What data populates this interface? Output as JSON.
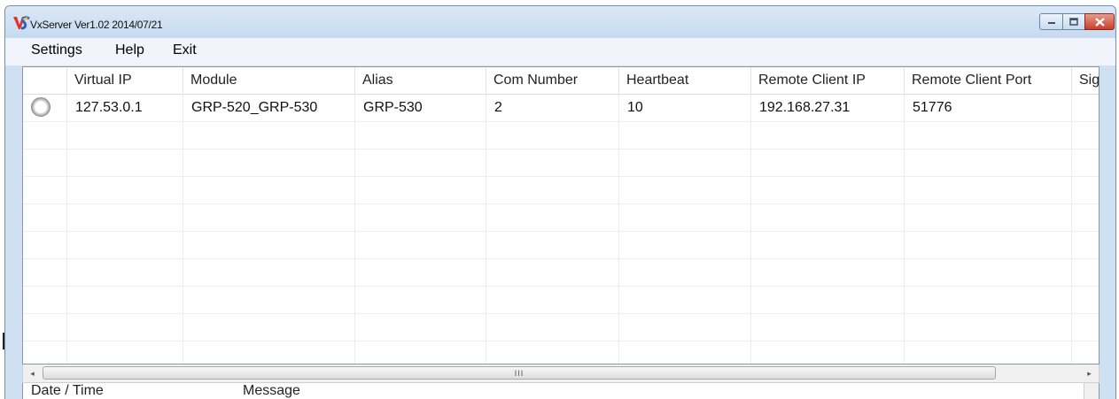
{
  "window": {
    "title": "VxServer Ver1.02 2014/07/21",
    "app_icon": "vs-logo-icon",
    "controls": [
      "minimize-icon",
      "maximize-icon",
      "close-icon"
    ],
    "accent_color": "#cfe0f3",
    "close_color": "#c7402a"
  },
  "menu": {
    "settings": "Settings",
    "help": "Help",
    "exit": "Exit"
  },
  "table": {
    "columns": [
      "Virtual IP",
      "Module",
      "Alias",
      "Com Number",
      "Heartbeat",
      "Remote Client IP",
      "Remote Client Port",
      "Sig"
    ],
    "rows": [
      {
        "status": "inactive",
        "virtual_ip": "127.53.0.1",
        "module": "GRP-520_GRP-530",
        "alias": "GRP-530",
        "com_number": "2",
        "heartbeat": "10",
        "remote_client_ip": "192.168.27.31",
        "remote_client_port": "51776",
        "sig": ""
      }
    ]
  },
  "scrollbar": {
    "left_arrow": "◂",
    "right_arrow": "▸",
    "grip": "III"
  },
  "log": {
    "columns": [
      "Date / Time",
      "Message"
    ]
  }
}
